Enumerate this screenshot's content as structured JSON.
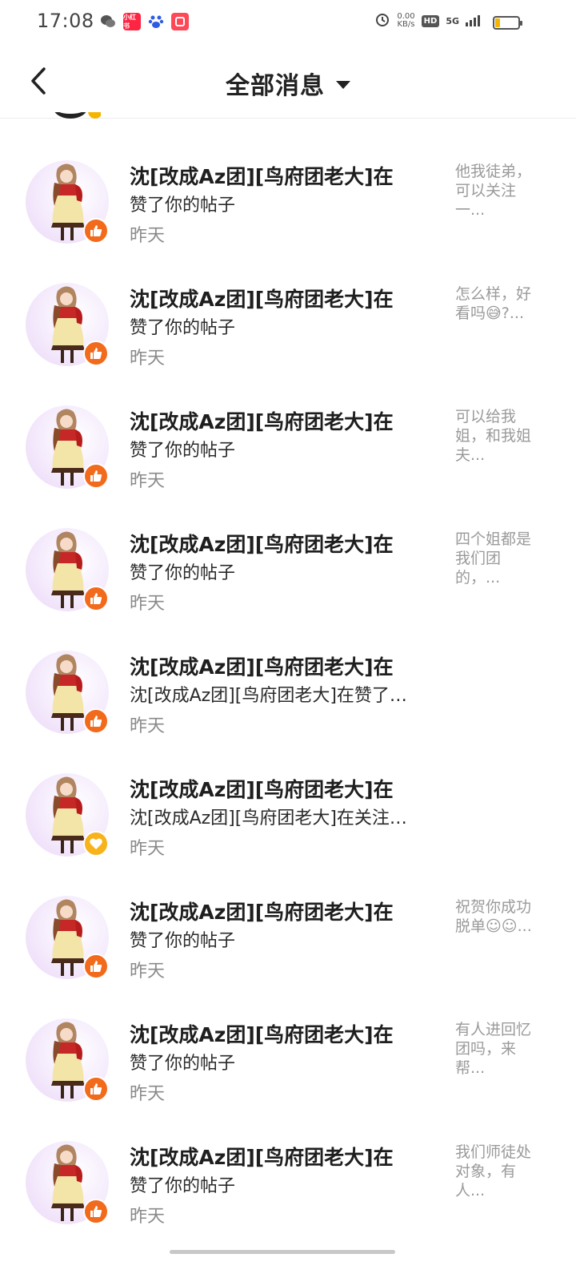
{
  "status_bar": {
    "time": "17:08",
    "speed_value": "0.00",
    "speed_unit": "KB/s",
    "hd": "HD",
    "network": "5G",
    "app_icons": [
      "wechat-icon",
      "xiaohongshu-icon",
      "baidu-icon",
      "app-icon"
    ]
  },
  "header": {
    "title": "全部消息",
    "back_icon": "chevron-left-icon",
    "dropdown_icon": "triangle-down-icon"
  },
  "colors": {
    "like_badge": "#f26a1b",
    "follow_badge": "#f8b21a"
  },
  "messages": [
    {
      "name": "沈[改成Az团][鸟府团老大]在",
      "action": "赞了你的帖子",
      "time": "昨天",
      "preview": "他我徒弟，可以关注一...",
      "badge": "like"
    },
    {
      "name": "沈[改成Az团][鸟府团老大]在",
      "action": "赞了你的帖子",
      "time": "昨天",
      "preview": "怎么样，好看吗😅?...",
      "badge": "like"
    },
    {
      "name": "沈[改成Az团][鸟府团老大]在",
      "action": "赞了你的帖子",
      "time": "昨天",
      "preview": "可以给我姐，和我姐夫...",
      "badge": "like"
    },
    {
      "name": "沈[改成Az团][鸟府团老大]在",
      "action": "赞了你的帖子",
      "time": "昨天",
      "preview": "四个姐都是我们团的，...",
      "badge": "like"
    },
    {
      "name": "沈[改成Az团][鸟府团老大]在",
      "action": "沈[改成Az团][鸟府团老大]在赞了…",
      "time": "昨天",
      "preview": "",
      "badge": "like"
    },
    {
      "name": "沈[改成Az团][鸟府团老大]在",
      "action": "沈[改成Az团][鸟府团老大]在关注…",
      "time": "昨天",
      "preview": "",
      "badge": "follow"
    },
    {
      "name": "沈[改成Az团][鸟府团老大]在",
      "action": "赞了你的帖子",
      "time": "昨天",
      "preview": "祝贺你成功脱单☺☺...",
      "badge": "like"
    },
    {
      "name": "沈[改成Az团][鸟府团老大]在",
      "action": "赞了你的帖子",
      "time": "昨天",
      "preview": "有人进回忆团吗，来帮...",
      "badge": "like"
    },
    {
      "name": "沈[改成Az团][鸟府团老大]在",
      "action": "赞了你的帖子",
      "time": "昨天",
      "preview": "我们师徒处对象，有人...",
      "badge": "like"
    }
  ]
}
